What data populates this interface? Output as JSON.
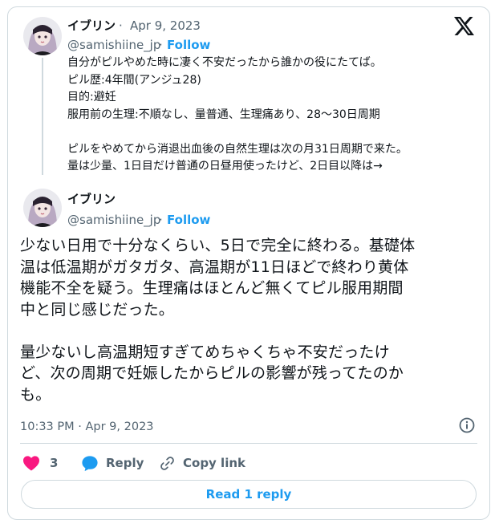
{
  "parent_tweet": {
    "author_name": "イブリン",
    "separator": "·",
    "date": "Apr 9, 2023",
    "handle": "@samishiine_jp",
    "follow_label": "Follow",
    "lines": [
      "自分がピルやめた時に凄く不安だったから誰かの役にたてば。",
      "ピル歴:4年間(アンジュ28)",
      "目的:避妊",
      "服用前の生理:不順なし、量普通、生理痛あり、28〜30日周期",
      "",
      "ピルをやめてから消退出血後の自然生理は次の月31日周期で来た。",
      "量は少量、1日目だけ普通の日昼用使ったけど、2日目以降は→"
    ]
  },
  "main_tweet": {
    "author_name": "イブリン",
    "handle": "@samishiine_jp",
    "separator": "·",
    "follow_label": "Follow",
    "lines": [
      "少ない日用で十分なくらい、5日で完全に終わる。基礎体",
      "温は低温期がガタガタ、高温期が11日ほどで終わり黄体",
      "機能不全を疑う。生理痛はほとんど無くてピル服用期間",
      "中と同じ感じだった。",
      "",
      "量少ないし高温期短すぎてめちゃくちゃ不安だったけ",
      "ど、次の周期で妊娠したからピルの影響が残ってたのか",
      "も。"
    ],
    "timestamp": "10:33 PM · Apr 9, 2023"
  },
  "actions": {
    "like_count": "3",
    "reply_label": "Reply",
    "copy_link_label": "Copy link"
  },
  "read_reply_label": "Read 1 reply",
  "icons": {
    "brand": "x-logo-icon",
    "info": "info-icon",
    "like": "heart-icon",
    "reply": "speech-bubble-icon",
    "copy": "link-icon"
  },
  "colors": {
    "accent": "#1d9bf0",
    "like": "#f91880",
    "secondary_text": "#536471",
    "border": "#cfd9de"
  }
}
